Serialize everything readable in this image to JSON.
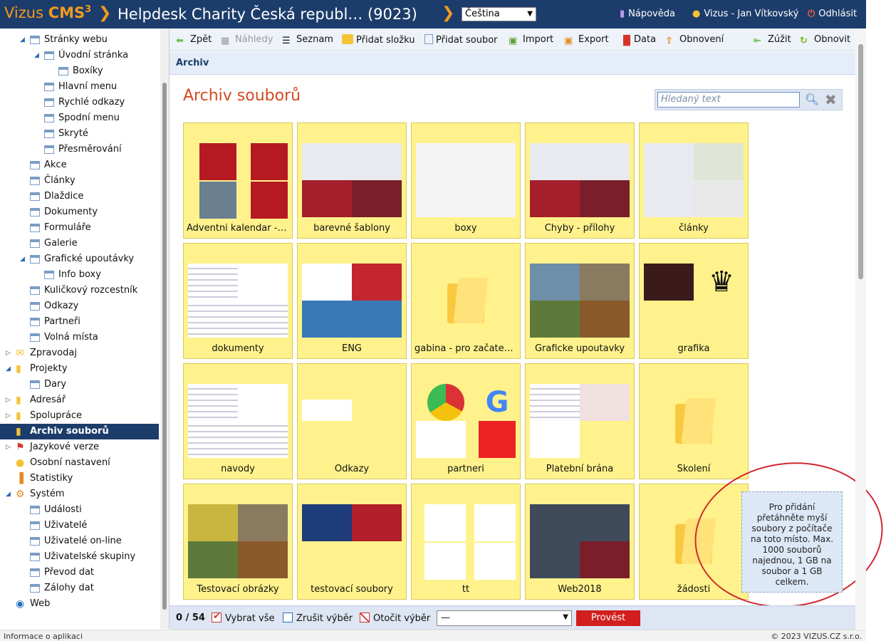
{
  "app": {
    "logo_a": "Vizus",
    "logo_b": "CMS",
    "logo_sup": "3",
    "site_title": "Helpdesk Charity Česká republ… (9023)",
    "language": "Čeština",
    "help": "Nápověda",
    "user": "Vizus - Jan Vítkovský",
    "logout": "Odhlásit"
  },
  "sidebar": {
    "items": [
      {
        "label": "Stránky webu",
        "indent": 1,
        "icon": "page",
        "expand": "open"
      },
      {
        "label": "Úvodní stránka",
        "indent": 2,
        "icon": "page",
        "expand": "open"
      },
      {
        "label": "Boxíky",
        "indent": 3,
        "icon": "page",
        "expand": ""
      },
      {
        "label": "Hlavní menu",
        "indent": 2,
        "icon": "page",
        "expand": ""
      },
      {
        "label": "Rychlé odkazy",
        "indent": 2,
        "icon": "page",
        "expand": ""
      },
      {
        "label": "Spodní menu",
        "indent": 2,
        "icon": "page",
        "expand": ""
      },
      {
        "label": "Skryté",
        "indent": 2,
        "icon": "page",
        "expand": ""
      },
      {
        "label": "Přesměrování",
        "indent": 2,
        "icon": "page",
        "expand": ""
      },
      {
        "label": "Akce",
        "indent": 1,
        "icon": "page",
        "expand": ""
      },
      {
        "label": "Články",
        "indent": 1,
        "icon": "page",
        "expand": ""
      },
      {
        "label": "Dlaždice",
        "indent": 1,
        "icon": "page",
        "expand": ""
      },
      {
        "label": "Dokumenty",
        "indent": 1,
        "icon": "page",
        "expand": ""
      },
      {
        "label": "Formuláře",
        "indent": 1,
        "icon": "page",
        "expand": ""
      },
      {
        "label": "Galerie",
        "indent": 1,
        "icon": "page",
        "expand": ""
      },
      {
        "label": "Grafické upoutávky",
        "indent": 1,
        "icon": "page",
        "expand": "open"
      },
      {
        "label": "Info boxy",
        "indent": 2,
        "icon": "page",
        "expand": ""
      },
      {
        "label": "Kuličkový rozcestník",
        "indent": 1,
        "icon": "page",
        "expand": ""
      },
      {
        "label": "Odkazy",
        "indent": 1,
        "icon": "page",
        "expand": ""
      },
      {
        "label": "Partneři",
        "indent": 1,
        "icon": "page",
        "expand": ""
      },
      {
        "label": "Volná místa",
        "indent": 1,
        "icon": "page",
        "expand": ""
      },
      {
        "label": "Zpravodaj",
        "indent": 0,
        "icon": "mail",
        "expand": "closed"
      },
      {
        "label": "Projekty",
        "indent": 0,
        "icon": "folder",
        "expand": "open"
      },
      {
        "label": "Dary",
        "indent": 1,
        "icon": "page",
        "expand": ""
      },
      {
        "label": "Adresář",
        "indent": 0,
        "icon": "book",
        "expand": "closed"
      },
      {
        "label": "Spolupráce",
        "indent": 0,
        "icon": "collab",
        "expand": "closed"
      },
      {
        "label": "Archiv souborů",
        "indent": 0,
        "icon": "archive",
        "expand": "",
        "selected": true
      },
      {
        "label": "Jazykové verze",
        "indent": 0,
        "icon": "flag",
        "expand": "closed"
      },
      {
        "label": "Osobní nastavení",
        "indent": 0,
        "icon": "person",
        "expand": ""
      },
      {
        "label": "Statistiky",
        "indent": 0,
        "icon": "chart",
        "expand": ""
      },
      {
        "label": "Systém",
        "indent": 0,
        "icon": "gear",
        "expand": "open"
      },
      {
        "label": "Události",
        "indent": 1,
        "icon": "page",
        "expand": ""
      },
      {
        "label": "Uživatelé",
        "indent": 1,
        "icon": "page",
        "expand": ""
      },
      {
        "label": "Uživatelé on-line",
        "indent": 1,
        "icon": "page",
        "expand": ""
      },
      {
        "label": "Uživatelské skupiny",
        "indent": 1,
        "icon": "page",
        "expand": ""
      },
      {
        "label": "Převod dat",
        "indent": 1,
        "icon": "page",
        "expand": ""
      },
      {
        "label": "Zálohy dat",
        "indent": 1,
        "icon": "page",
        "expand": ""
      },
      {
        "label": "Web",
        "indent": 0,
        "icon": "globe",
        "expand": ""
      }
    ]
  },
  "toolbar": {
    "back": "Zpět",
    "previews": "Náhledy",
    "list": "Seznam",
    "add_folder": "Přidat složku",
    "add_file": "Přidat soubor",
    "import": "Import",
    "export": "Export",
    "data": "Data",
    "refresh": "Obnovení",
    "narrow": "Zúžit",
    "reload": "Obnovit"
  },
  "breadcrumb": "Archiv",
  "page": {
    "title": "Archiv souborů",
    "search_placeholder": "Hledaný text"
  },
  "tiles": [
    {
      "label": "Adventni kalendar - …",
      "kind": "advent"
    },
    {
      "label": "barevné šablony",
      "kind": "shots"
    },
    {
      "label": "boxy",
      "kind": "light"
    },
    {
      "label": "Chyby - přílohy",
      "kind": "shots"
    },
    {
      "label": "články",
      "kind": "mixed"
    },
    {
      "label": "dokumenty",
      "kind": "docs"
    },
    {
      "label": "ENG",
      "kind": "eng"
    },
    {
      "label": "gabina - pro začateč…",
      "kind": "folder"
    },
    {
      "label": "Graficke upoutavky",
      "kind": "photos"
    },
    {
      "label": "grafika",
      "kind": "grafika"
    },
    {
      "label": "navody",
      "kind": "docs2"
    },
    {
      "label": "Odkazy",
      "kind": "logos"
    },
    {
      "label": "partneri",
      "kind": "partneri"
    },
    {
      "label": "Platební brána",
      "kind": "brana"
    },
    {
      "label": "Školení",
      "kind": "folder"
    },
    {
      "label": "Testovací obrázky",
      "kind": "nature"
    },
    {
      "label": "testovací soubory",
      "kind": "testsoub"
    },
    {
      "label": "tt",
      "kind": "tt"
    },
    {
      "label": "Web2018",
      "kind": "web"
    },
    {
      "label": "žádosti",
      "kind": "folder"
    }
  ],
  "dropzone": "Pro přidání přetáhněte myší soubory z počítače na toto místo. Max. 1000 souborů najednou, 1 GB na soubor a 1 GB celkem.",
  "bottom": {
    "count": "0 / 54",
    "select_all": "Vybrat vše",
    "deselect": "Zrušit výběr",
    "invert": "Otočit výběr",
    "action": "—",
    "run": "Provést"
  },
  "footer": {
    "left": "Informace o aplikaci",
    "right": "© 2023 VIZUS.CZ s.r.o."
  }
}
